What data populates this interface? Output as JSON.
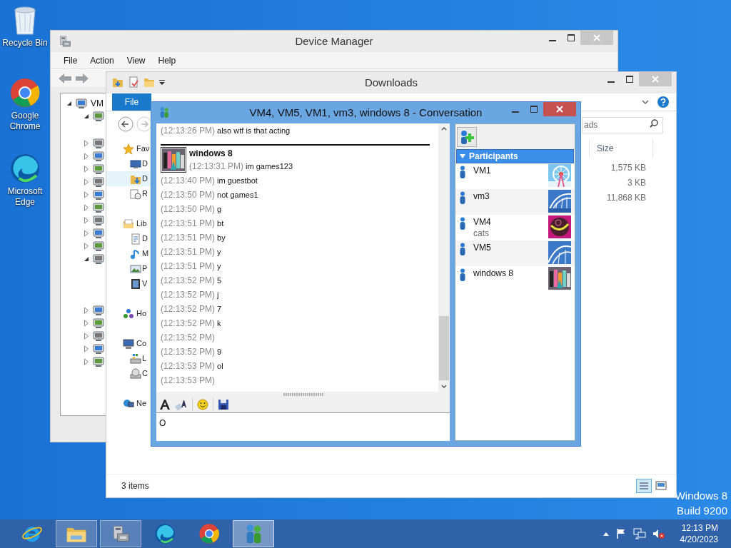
{
  "desktop_icons": [
    {
      "label": "Recycle Bin",
      "kind": "bin"
    },
    {
      "label": "Google Chrome",
      "kind": "chrome"
    },
    {
      "label": "Microsoft Edge",
      "kind": "edge"
    }
  ],
  "device_manager": {
    "title": "Device Manager",
    "menu": [
      "File",
      "Action",
      "View",
      "Help"
    ],
    "tree": {
      "label": "VM",
      "expanded": true,
      "children": [
        {
          "expanded": true
        },
        {
          "expanded": false
        },
        {
          "expanded": false
        },
        {
          "expanded": false
        },
        {
          "expanded": false
        },
        {
          "expanded": false
        },
        {
          "expanded": false
        },
        {
          "expanded": false
        },
        {
          "expanded": false
        },
        {
          "expanded": false
        },
        {
          "expanded": true
        },
        {
          "expanded": false
        },
        {
          "expanded": false
        },
        {
          "expanded": false
        },
        {
          "expanded": false
        },
        {
          "expanded": false
        }
      ]
    }
  },
  "downloads": {
    "title": "Downloads",
    "ribbon_tab": "File",
    "search": {
      "placeholder": "ads"
    },
    "nav": [
      {
        "label": "Fav",
        "kind": "star",
        "children": [
          {
            "label": "D",
            "kind": "desktop",
            "selected": false
          },
          {
            "label": "D",
            "kind": "download",
            "selected": true
          },
          {
            "label": "R",
            "kind": "recent",
            "selected": false
          }
        ]
      },
      {
        "label": "Lib",
        "kind": "library",
        "children": [
          {
            "label": "D",
            "kind": "doc",
            "selected": false
          },
          {
            "label": "M",
            "kind": "music",
            "selected": false
          },
          {
            "label": "P",
            "kind": "pictures",
            "selected": false
          },
          {
            "label": "V",
            "kind": "video",
            "selected": false
          }
        ]
      },
      {
        "label": "Ho",
        "kind": "homegroup"
      },
      {
        "label": "Co",
        "kind": "computer",
        "children": [
          {
            "label": "L",
            "kind": "disk",
            "selected": false
          },
          {
            "label": "C",
            "kind": "cd",
            "selected": false
          }
        ]
      },
      {
        "label": "Ne",
        "kind": "network"
      }
    ],
    "columns": [
      "Size"
    ],
    "rows": [
      {
        "size": "1,575 KB"
      },
      {
        "size": "3 KB"
      },
      {
        "size": "11,868 KB"
      }
    ],
    "status": "3 items"
  },
  "conversation": {
    "title": "VM4, VM5, VM1, vm3, windows 8 - Conversation",
    "message_groups": [
      {
        "messages": [
          {
            "time": "(12:13:26 PM)",
            "text": "also wtf is that acting"
          }
        ]
      },
      {
        "sender": "windows 8",
        "messages": [
          {
            "time": "(12:13:31 PM)",
            "text": "im games123"
          },
          {
            "time": "(12:13:40 PM)",
            "text": "im guestbot"
          },
          {
            "time": "(12:13:50 PM)",
            "text": "not games1"
          },
          {
            "time": "(12:13:50 PM)",
            "text": "g"
          },
          {
            "time": "(12:13:51 PM)",
            "text": "bt"
          },
          {
            "time": "(12:13:51 PM)",
            "text": "by"
          },
          {
            "time": "(12:13:51 PM)",
            "text": "y"
          },
          {
            "time": "(12:13:51 PM)",
            "text": "y"
          },
          {
            "time": "(12:13:52 PM)",
            "text": "5"
          },
          {
            "time": "(12:13:52 PM)",
            "text": "j"
          },
          {
            "time": "(12:13:52 PM)",
            "text": "7"
          },
          {
            "time": "(12:13:52 PM)",
            "text": "k"
          },
          {
            "time": "(12:13:52 PM)"
          },
          {
            "time": "(12:13:52 PM)",
            "text": "9"
          },
          {
            "time": "(12:13:53 PM)",
            "text": "ol"
          },
          {
            "time": "(12:13:53 PM)"
          }
        ]
      }
    ],
    "input": {
      "value": "O"
    },
    "participants_header": "Participants",
    "participants": [
      {
        "name": "VM1"
      },
      {
        "name": "vm3"
      },
      {
        "name": "VM4",
        "status": "cats"
      },
      {
        "name": "VM5"
      },
      {
        "name": "windows 8"
      }
    ]
  },
  "watermark": [
    "Windows 8",
    "Build 9200"
  ],
  "taskbar": {
    "apps": [
      {
        "kind": "ie",
        "running": false,
        "selected": false
      },
      {
        "kind": "explorer",
        "running": true,
        "selected": false
      },
      {
        "kind": "devmgr",
        "running": true,
        "selected": false
      },
      {
        "kind": "edge",
        "running": false,
        "selected": false
      },
      {
        "kind": "chrome",
        "running": false,
        "selected": false
      },
      {
        "kind": "messenger",
        "running": true,
        "selected": true
      }
    ],
    "time": "12:13 PM",
    "date": "4/20/2023"
  }
}
